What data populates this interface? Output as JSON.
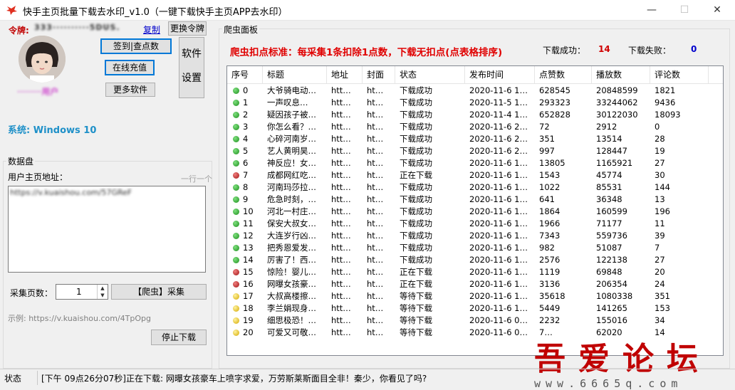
{
  "window": {
    "title": "快手主页批量下载去水印_v1.0（一键下载快手主页APP去水印）",
    "minimize_glyph": "—",
    "maximize_glyph": "☐",
    "close_glyph": "✕"
  },
  "left": {
    "token_label": "令牌:",
    "token_value": "333··········5DUS.",
    "copy_label": "复制",
    "change_token_label": "更换令牌",
    "checkin_label": "签到|查点数",
    "recharge_label": "在线充值",
    "more_software_label": "更多软件",
    "software_settings_label_1": "软件",
    "software_settings_label_2": "设置",
    "username": "·········用户",
    "system_text": "系统: Windows 10",
    "datapan_title": "数据盘",
    "homepage_label": "用户主页地址：",
    "homepage_hint": "一行一个",
    "homepage_value": "https://v.kuaishou.com/57GReF",
    "pages_label": "采集页数：",
    "pages_value": "1",
    "crawl_button": "【爬虫】采集",
    "example_text": "示例: https://v.kuaishou.com/4TpOpg",
    "stop_button": "停止下载"
  },
  "right": {
    "panel_title": "爬虫面板",
    "notice": "爬虫扣点标准：每采集1条扣除1点数，下载无扣点(点表格排序)",
    "success_label": "下载成功：",
    "success_value": "14",
    "fail_label": "下载失败：",
    "fail_value": "0",
    "columns": [
      "序号",
      "标题",
      "地址",
      "封面",
      "状态",
      "发布时间",
      "点赞数",
      "播放数",
      "评论数"
    ]
  },
  "table_rows": [
    {
      "status_color": "green",
      "index": "0",
      "title": "大爷骑电动…",
      "url": "htt…",
      "cover": "ht…",
      "status": "下载成功",
      "time": "2020-11-6 1…",
      "likes": "628545",
      "plays": "20848599",
      "comments": "1821"
    },
    {
      "status_color": "green",
      "index": "1",
      "title": "一声叹息…",
      "url": "htt…",
      "cover": "ht…",
      "status": "下载成功",
      "time": "2020-11-5 1…",
      "likes": "293323",
      "plays": "33244062",
      "comments": "9436"
    },
    {
      "status_color": "green",
      "index": "2",
      "title": "疑因孩子被…",
      "url": "htt…",
      "cover": "ht…",
      "status": "下载成功",
      "time": "2020-11-4 1…",
      "likes": "652828",
      "plays": "30122030",
      "comments": "18093"
    },
    {
      "status_color": "green",
      "index": "3",
      "title": "你怎么看？…",
      "url": "htt…",
      "cover": "ht…",
      "status": "下载成功",
      "time": "2020-11-6 2…",
      "likes": "72",
      "plays": "2912",
      "comments": "0"
    },
    {
      "status_color": "green",
      "index": "4",
      "title": "心碎河南岁…",
      "url": "htt…",
      "cover": "ht…",
      "status": "下载成功",
      "time": "2020-11-6 2…",
      "likes": "351",
      "plays": "13514",
      "comments": "28"
    },
    {
      "status_color": "green",
      "index": "5",
      "title": "艺人黄明昊…",
      "url": "htt…",
      "cover": "ht…",
      "status": "下载成功",
      "time": "2020-11-6 2…",
      "likes": "997",
      "plays": "128447",
      "comments": "19"
    },
    {
      "status_color": "green",
      "index": "6",
      "title": "神反应！女…",
      "url": "htt…",
      "cover": "ht…",
      "status": "下载成功",
      "time": "2020-11-6 1…",
      "likes": "13805",
      "plays": "1165921",
      "comments": "27"
    },
    {
      "status_color": "red",
      "index": "7",
      "title": "成都网红吃…",
      "url": "htt…",
      "cover": "ht…",
      "status": "正在下载",
      "time": "2020-11-6 1…",
      "likes": "1543",
      "plays": "45774",
      "comments": "30"
    },
    {
      "status_color": "green",
      "index": "8",
      "title": "河南玛莎拉…",
      "url": "htt…",
      "cover": "ht…",
      "status": "下载成功",
      "time": "2020-11-6 1…",
      "likes": "1022",
      "plays": "85531",
      "comments": "144"
    },
    {
      "status_color": "green",
      "index": "9",
      "title": "危急时刻，…",
      "url": "htt…",
      "cover": "ht…",
      "status": "下载成功",
      "time": "2020-11-6 1…",
      "likes": "641",
      "plays": "36348",
      "comments": "13"
    },
    {
      "status_color": "green",
      "index": "10",
      "title": "河北一村庄…",
      "url": "htt…",
      "cover": "ht…",
      "status": "下载成功",
      "time": "2020-11-6 1…",
      "likes": "1864",
      "plays": "160599",
      "comments": "196"
    },
    {
      "status_color": "green",
      "index": "11",
      "title": "保安大叔女…",
      "url": "htt…",
      "cover": "ht…",
      "status": "下载成功",
      "time": "2020-11-6 1…",
      "likes": "1966",
      "plays": "71177",
      "comments": "11"
    },
    {
      "status_color": "green",
      "index": "12",
      "title": "大连岁行凶…",
      "url": "htt…",
      "cover": "ht…",
      "status": "下载成功",
      "time": "2020-11-6 1…",
      "likes": "7343",
      "plays": "559736",
      "comments": "39"
    },
    {
      "status_color": "green",
      "index": "13",
      "title": "把秀恩爱发…",
      "url": "htt…",
      "cover": "ht…",
      "status": "下载成功",
      "time": "2020-11-6 1…",
      "likes": "982",
      "plays": "51087",
      "comments": "7"
    },
    {
      "status_color": "green",
      "index": "14",
      "title": "厉害了！西…",
      "url": "htt…",
      "cover": "ht…",
      "status": "下载成功",
      "time": "2020-11-6 1…",
      "likes": "2576",
      "plays": "122138",
      "comments": "27"
    },
    {
      "status_color": "red",
      "index": "15",
      "title": "惊险！婴儿…",
      "url": "htt…",
      "cover": "ht…",
      "status": "正在下载",
      "time": "2020-11-6 1…",
      "likes": "1119",
      "plays": "69848",
      "comments": "20"
    },
    {
      "status_color": "red",
      "index": "16",
      "title": "网曝女孩豪…",
      "url": "htt…",
      "cover": "ht…",
      "status": "正在下载",
      "time": "2020-11-6 1…",
      "likes": "3136",
      "plays": "206354",
      "comments": "24"
    },
    {
      "status_color": "yellow",
      "index": "17",
      "title": "大叔高楼擦…",
      "url": "htt…",
      "cover": "ht…",
      "status": "等待下载",
      "time": "2020-11-6 1…",
      "likes": "35618",
      "plays": "1080338",
      "comments": "351"
    },
    {
      "status_color": "yellow",
      "index": "18",
      "title": "李兰娟现身…",
      "url": "htt…",
      "cover": "ht…",
      "status": "等待下载",
      "time": "2020-11-6 1…",
      "likes": "5449",
      "plays": "141265",
      "comments": "153"
    },
    {
      "status_color": "yellow",
      "index": "19",
      "title": "细思极恐！…",
      "url": "htt…",
      "cover": "ht…",
      "status": "等待下载",
      "time": "2020-11-6 0…",
      "likes": "2232",
      "plays": "155016",
      "comments": "34"
    },
    {
      "status_color": "yellow",
      "index": "20",
      "title": "可爱又可敬…",
      "url": "htt…",
      "cover": "ht…",
      "status": "等待下载",
      "time": "2020-11-6 0…",
      "likes": "7…",
      "plays": "62020",
      "comments": "14"
    }
  ],
  "watermark": {
    "text": "吾爱论坛",
    "url": "www.6665q.com"
  },
  "status_bar": {
    "label": "状态",
    "message": "[下午 09点26分07秒]正在下载: 网曝女孩豪车上喷字求爱，万劳斯莱斯面目全非！秦少，你看见了吗?"
  },
  "colors": {
    "green": "#1c8e1c",
    "red": "#a01010",
    "yellow": "#d4a800",
    "notice_red": "#e00000",
    "stat_red": "#d00000",
    "stat_blue": "#0000cc",
    "system_blue": "#1e90c8"
  }
}
